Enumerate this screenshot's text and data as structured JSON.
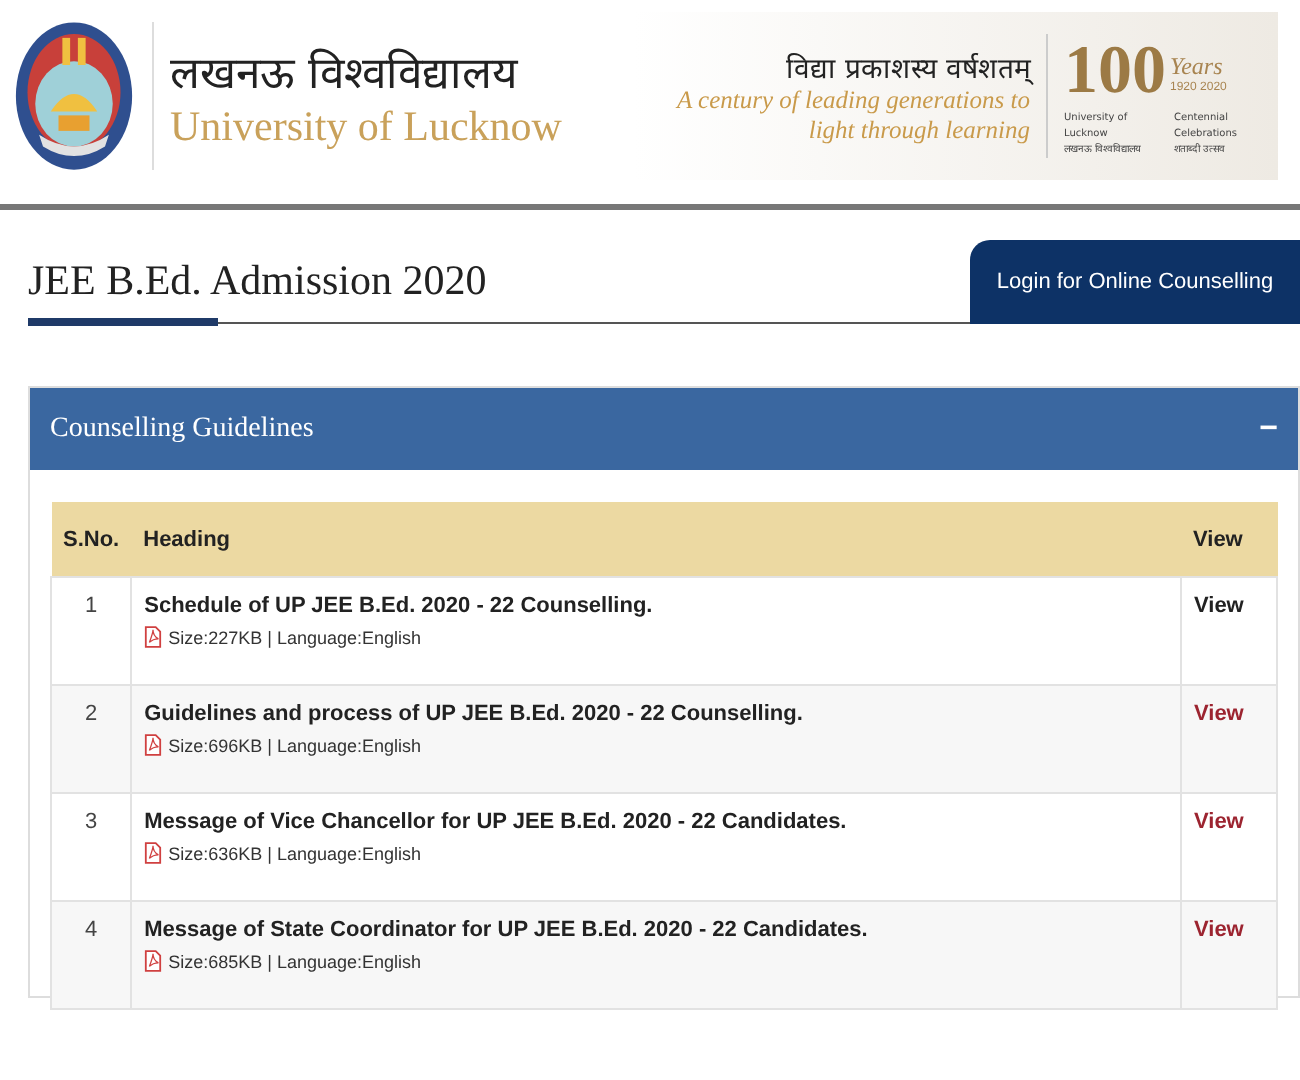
{
  "header": {
    "hindi_name": "लखनऊ विश्वविद्यालय",
    "name": "University of Lucknow",
    "motto": "विद्या प्रकाशस्य वर्षशतम्",
    "tagline_1": "A century of leading generations to",
    "tagline_2": "light through learning",
    "centenary": {
      "number": "100",
      "years": "Years",
      "span": "1920 2020",
      "left_en": "University of Lucknow",
      "left_hi": "लखनऊ विश्वविद्यालय",
      "right_en": "Centennial Celebrations",
      "right_hi": "शताब्दी उत्सव"
    }
  },
  "page_title": "JEE B.Ed. Admission 2020",
  "login_button": "Login for Online Counselling",
  "panel": {
    "title": "Counselling Guidelines",
    "expanded": true,
    "collapse_symbol": "−"
  },
  "table": {
    "columns": [
      "S.No.",
      "Heading",
      "View"
    ],
    "rows": [
      {
        "sno": "1",
        "heading": "Schedule of  UP JEE B.Ed. 2020 - 22 Counselling.",
        "meta": "Size:227KB | Language:English",
        "view": "View",
        "hovered": true
      },
      {
        "sno": "2",
        "heading": "Guidelines and process of  UP JEE B.Ed. 2020 - 22 Counselling.",
        "meta": "Size:696KB | Language:English",
        "view": "View",
        "hovered": false
      },
      {
        "sno": "3",
        "heading": "Message of Vice Chancellor for UP JEE B.Ed. 2020 - 22 Candidates.",
        "meta": "Size:636KB | Language:English",
        "view": "View",
        "hovered": false
      },
      {
        "sno": "4",
        "heading": "Message of State Coordinator for UP JEE B.Ed. 2020 - 22 Candidates.",
        "meta": "Size:685KB | Language:English",
        "view": "View",
        "hovered": false
      }
    ]
  }
}
